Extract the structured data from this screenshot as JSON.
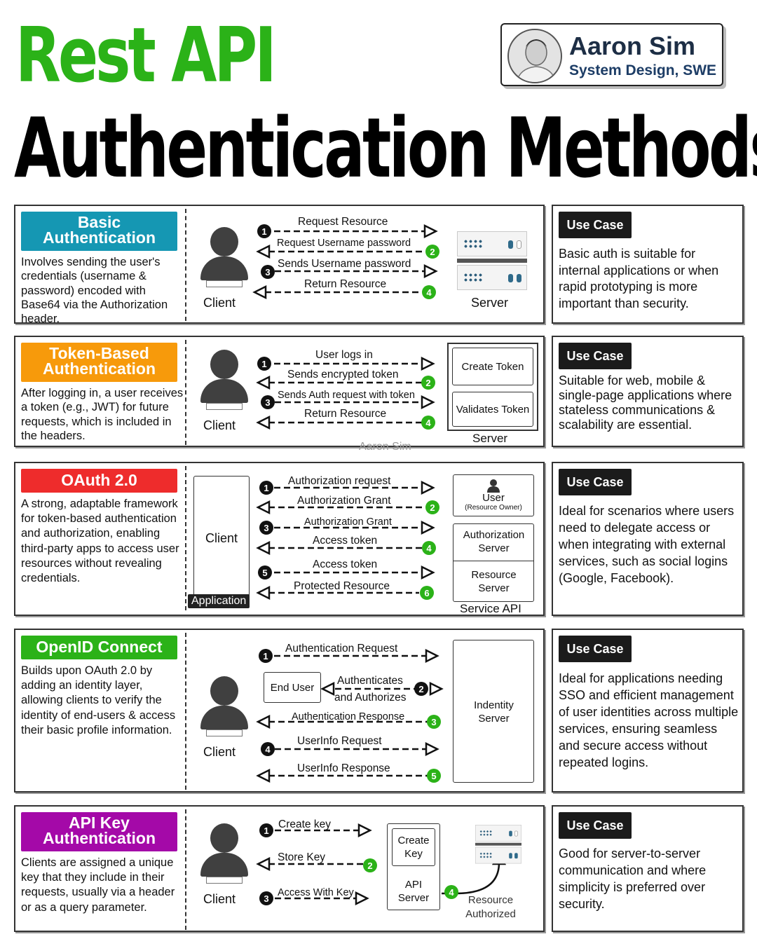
{
  "title": {
    "line1": "Rest API",
    "line2": "Authentication Methods"
  },
  "author": {
    "name": "Aaron Sim",
    "role": "System Design, SWE"
  },
  "colors": {
    "green": "#2bb218",
    "teal": "#1597b3",
    "orange": "#f79a0b",
    "red": "#ee2c2c",
    "purple": "#a409a8"
  },
  "watermark": "Aaron Sim",
  "use_case_label": "Use Case",
  "sections": [
    {
      "name_lines": [
        "Basic",
        "Authentication"
      ],
      "description": "Involves sending the user's credentials (username & password) encoded with Base64 via the Authorization header.",
      "client_label": "Client",
      "server_label": "Server",
      "steps": [
        {
          "n": "1",
          "label": "Request Resource"
        },
        {
          "n": "2",
          "label": "Request Username password"
        },
        {
          "n": "3",
          "label": "Sends Username password"
        },
        {
          "n": "4",
          "label": "Return Resource"
        }
      ],
      "use_case": "Basic auth is suitable for internal applications or when rapid prototyping is more important than security."
    },
    {
      "name_lines": [
        "Token-Based",
        "Authentication"
      ],
      "description": "After logging in, a user receives a token (e.g., JWT) for future requests, which is included in the headers.",
      "client_label": "Client",
      "server_label": "Server",
      "boxes": [
        "Create Token",
        "Validates Token"
      ],
      "steps": [
        {
          "n": "1",
          "label": "User logs in"
        },
        {
          "n": "2",
          "label": "Sends encrypted token"
        },
        {
          "n": "3",
          "label": "Sends Auth request with token"
        },
        {
          "n": "4",
          "label": "Return Resource"
        }
      ],
      "use_case": "Suitable for web, mobile & single-page applications where stateless communications & scalability are essential."
    },
    {
      "name_lines": [
        "OAuth 2.0"
      ],
      "description": "A strong, adaptable framework for token-based authentication and authorization, enabling third-party apps to access user resources without revealing credentials.",
      "client_label": "Client",
      "application_label": "Application",
      "user_label": "User",
      "user_sub": "(Resource Owner)",
      "auth_server": "Authorization Server",
      "resource_server": "Resource Server",
      "service_label": "Service API",
      "steps": [
        {
          "n": "1",
          "label": "Authorization request"
        },
        {
          "n": "2",
          "label": "Authorization Grant"
        },
        {
          "n": "3",
          "label": "Authorization Grant"
        },
        {
          "n": "4",
          "label": "Access token"
        },
        {
          "n": "5",
          "label": "Access token"
        },
        {
          "n": "6",
          "label": "Protected Resource"
        }
      ],
      "use_case": "Ideal for scenarios where users need to delegate access or when integrating with external services, such as social logins (Google, Facebook)."
    },
    {
      "name_lines": [
        "OpenID Connect"
      ],
      "description": "Builds upon OAuth 2.0 by adding an identity layer, allowing clients to verify the identity of end-users & access their basic profile information.",
      "client_label": "Client",
      "end_user": "End User",
      "identity_server": "Indentity Server",
      "authenticates": "Authenticates",
      "and_authorizes": "and Authorizes",
      "steps": [
        {
          "n": "1",
          "label": "Authentication Request"
        },
        {
          "n": "2",
          "label": ""
        },
        {
          "n": "3",
          "label": "Authentication Response"
        },
        {
          "n": "4",
          "label": "UserInfo Request"
        },
        {
          "n": "5",
          "label": "UserInfo Response"
        }
      ],
      "use_case": "Ideal for applications needing SSO and efficient management of user identities across multiple services, ensuring seamless and secure access without repeated logins."
    },
    {
      "name_lines": [
        "API Key",
        "Authentication"
      ],
      "description": "Clients are assigned a unique key that they include in their requests, usually via a header or as a query parameter.",
      "client_label": "Client",
      "create_key": "Create Key",
      "api_server": "API Server",
      "resource_authorized": "Resource Authorized",
      "steps": [
        {
          "n": "1",
          "label": "Create key"
        },
        {
          "n": "2",
          "label": "Store Key"
        },
        {
          "n": "3",
          "label": "Access With Key"
        },
        {
          "n": "4",
          "label": ""
        }
      ],
      "use_case": "Good for server-to-server communication and where simplicity is preferred over security."
    }
  ]
}
